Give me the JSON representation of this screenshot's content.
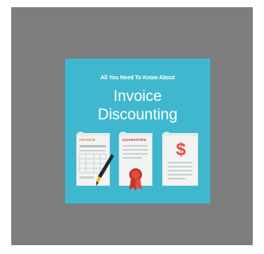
{
  "card": {
    "eyebrow": "All You Need To Know About",
    "title_line1": "Invoice",
    "title_line2": "Discounting",
    "docs": {
      "invoice_label": "INVOICE",
      "guarantee_label": "GUARANTEE",
      "dollar_symbol": "$"
    }
  },
  "colors": {
    "card_background": "#3fb8cf",
    "panel_background": "#7d7d7d",
    "accent_red": "#e74c3c",
    "accent_orange": "#e67e22",
    "pen_gold": "#f1c40f"
  },
  "icons": [
    "invoice-document-icon",
    "pen-icon",
    "guarantee-document-icon",
    "seal-icon",
    "dollar-document-icon"
  ]
}
